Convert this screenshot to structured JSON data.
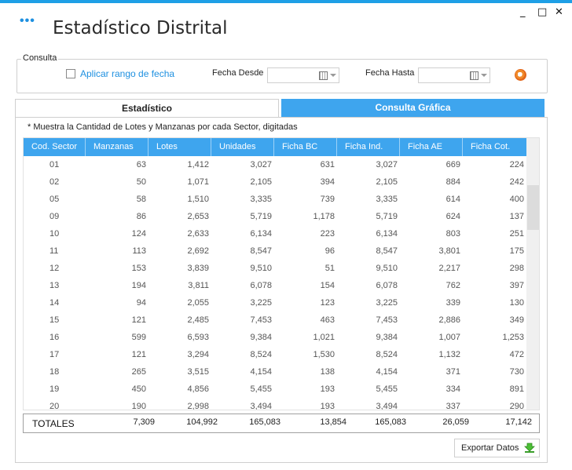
{
  "window": {
    "menu_glyph": "•••",
    "title": "Estadístico Distrital",
    "minimize": "_",
    "maximize": "□",
    "close": "✕"
  },
  "consulta": {
    "group_label": "Consulta",
    "checkbox_label": "Aplicar rango de fecha",
    "checkbox_checked": false,
    "fecha_desde_label": "Fecha Desde",
    "fecha_desde_value": "",
    "fecha_hasta_label": "Fecha Hasta",
    "fecha_hasta_value": "",
    "search_icon": "magnifier-icon"
  },
  "tabs": [
    {
      "label": "Estadístico",
      "active": true
    },
    {
      "label": "Consulta Gráfica",
      "active": false
    }
  ],
  "note": "* Muestra la Cantidad de Lotes y Manzanas por cada Sector, digitadas",
  "table": {
    "columns": [
      "Cod. Sector",
      "Manzanas",
      "Lotes",
      "Unidades",
      "Ficha BC",
      "Ficha Ind.",
      "Ficha AE",
      "Ficha Cot."
    ],
    "rows": [
      [
        "01",
        "63",
        "1,412",
        "3,027",
        "631",
        "3,027",
        "669",
        "224"
      ],
      [
        "02",
        "50",
        "1,071",
        "2,105",
        "394",
        "2,105",
        "884",
        "242"
      ],
      [
        "05",
        "58",
        "1,510",
        "3,335",
        "739",
        "3,335",
        "614",
        "400"
      ],
      [
        "09",
        "86",
        "2,653",
        "5,719",
        "1,178",
        "5,719",
        "624",
        "137"
      ],
      [
        "10",
        "124",
        "2,633",
        "6,134",
        "223",
        "6,134",
        "803",
        "251"
      ],
      [
        "11",
        "113",
        "2,692",
        "8,547",
        "96",
        "8,547",
        "3,801",
        "175"
      ],
      [
        "12",
        "153",
        "3,839",
        "9,510",
        "51",
        "9,510",
        "2,217",
        "298"
      ],
      [
        "13",
        "194",
        "3,811",
        "6,078",
        "154",
        "6,078",
        "762",
        "397"
      ],
      [
        "14",
        "94",
        "2,055",
        "3,225",
        "123",
        "3,225",
        "339",
        "130"
      ],
      [
        "15",
        "121",
        "2,485",
        "7,453",
        "463",
        "7,453",
        "2,886",
        "349"
      ],
      [
        "16",
        "599",
        "6,593",
        "9,384",
        "1,021",
        "9,384",
        "1,007",
        "1,253"
      ],
      [
        "17",
        "121",
        "3,294",
        "8,524",
        "1,530",
        "8,524",
        "1,132",
        "472"
      ],
      [
        "18",
        "265",
        "3,515",
        "4,154",
        "138",
        "4,154",
        "371",
        "730"
      ],
      [
        "19",
        "450",
        "4,856",
        "5,455",
        "193",
        "5,455",
        "334",
        "891"
      ],
      [
        "20",
        "190",
        "2,998",
        "3,494",
        "193",
        "3,494",
        "337",
        "290"
      ]
    ]
  },
  "totals": {
    "label": "TOTALES",
    "values": [
      "7,309",
      "104,992",
      "165,083",
      "13,854",
      "165,083",
      "26,059",
      "17,142"
    ]
  },
  "export": {
    "label": "Exportar Datos",
    "icon": "download-arrow-icon"
  },
  "colors": {
    "accent": "#1e9fe6",
    "header_bg": "#3ea5ee",
    "link": "#1e90e0"
  }
}
